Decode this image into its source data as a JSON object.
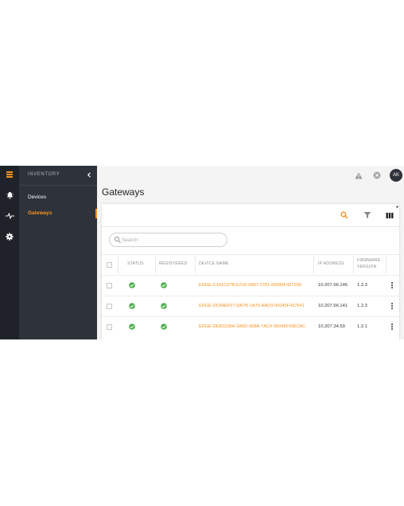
{
  "sidebar": {
    "title": "INVENTORY",
    "items": [
      {
        "label": "Devices",
        "active": false
      },
      {
        "label": "Gateways",
        "active": true
      }
    ],
    "rail_icons": [
      "inventory-icon",
      "alarm-icon",
      "pulse-icon",
      "settings-icon"
    ]
  },
  "header": {
    "icons": [
      "warning-icon",
      "close-icon"
    ],
    "avatar_initials": "AK"
  },
  "page": {
    "title": "Gateways"
  },
  "toolbar": {
    "icons": [
      "search-icon",
      "filter-icon",
      "columns-icon"
    ]
  },
  "search": {
    "placeholder": "Search",
    "value": ""
  },
  "table": {
    "columns": [
      "STATUS",
      "REGISTERED",
      "DEVICE NAME",
      "IP ADDRESS",
      "FIRMWARE",
      "VERSION"
    ],
    "rows": [
      {
        "device_name": "EDGE-C161C97B-E218-3A87-2781-00045F437299",
        "ip": "10.207.66.146",
        "firmware": "1.2.3"
      },
      {
        "device_name": "EDGE-DC84EF07-DA7B-1A79-AAD3-00045F437541",
        "ip": "10.207.66.141",
        "firmware": "1.2.3"
      },
      {
        "device_name": "EDGE-DE8231BA-2A6D-368A-7AC4-00045F436CAC",
        "ip": "10.207.34.59",
        "firmware": "1.2.1"
      }
    ]
  },
  "colors": {
    "accent": "#f7931e",
    "success": "#4caf50",
    "sidebar_dark": "#1f2329",
    "panel": "#2e333b"
  }
}
